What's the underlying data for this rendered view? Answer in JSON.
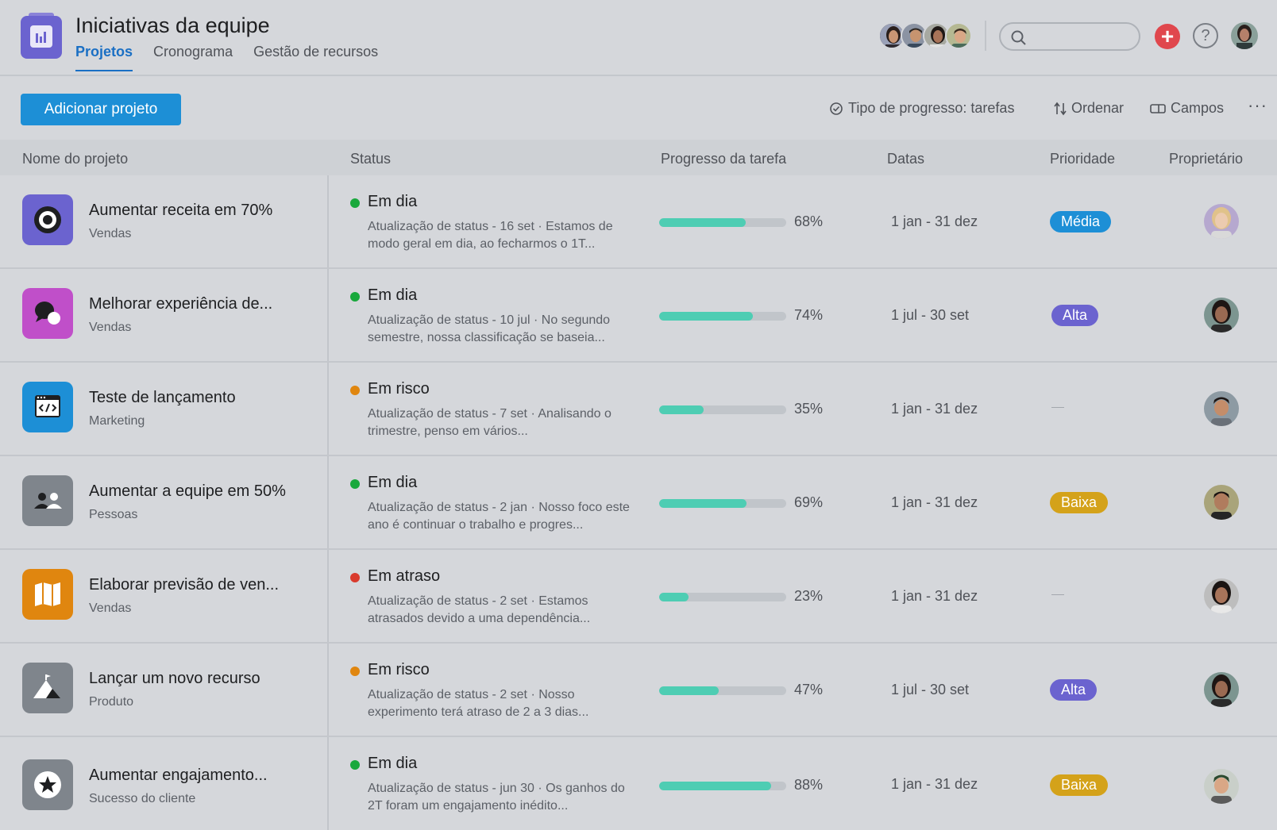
{
  "header": {
    "title": "Iniciativas da equipe",
    "tabs": [
      "Projetos",
      "Cronograma",
      "Gestão de recursos"
    ],
    "active_tab": "Projetos"
  },
  "toolbar": {
    "add_label": "Adicionar projeto",
    "progress_type_label": "Tipo de progresso: tarefas",
    "sort_label": "Ordenar",
    "fields_label": "Campos",
    "more_label": "···"
  },
  "columns": [
    "Nome do projeto",
    "Status",
    "Progresso da tarefa",
    "Datas",
    "Prioridade",
    "Proprietário"
  ],
  "colors": {
    "on_track": "#19a83c",
    "at_risk": "#e0860f",
    "late": "#d93a2d",
    "media": "#1d8fd6",
    "alta": "#6b63cf",
    "baixa": "#d4a21a",
    "progress": "#4ecdb3"
  },
  "rows": [
    {
      "name": "Aumentar receita em 70%",
      "team": "Vendas",
      "icon": "target-icon",
      "icon_color": "#6b63cf",
      "status": "Em dia",
      "status_color": "#19a83c",
      "desc": "Atualização de status - 16 set · Estamos de modo geral em dia, ao fecharmos o 1T...",
      "progress": 68,
      "progress_label": "68%",
      "dates": "1 jan - 31 dez",
      "priority": "Média",
      "priority_color": "#1d8fd6"
    },
    {
      "name": "Melhorar experiência de...",
      "team": "Vendas",
      "icon": "chat-bubbles-icon",
      "icon_color": "#c04fc9",
      "status": "Em dia",
      "status_color": "#19a83c",
      "desc": "Atualização de status - 10 jul · No segundo semestre, nossa classificação se baseia...",
      "progress": 74,
      "progress_label": "74%",
      "dates": "1 jul - 30 set",
      "priority": "Alta",
      "priority_color": "#6b63cf"
    },
    {
      "name": "Teste de lançamento",
      "team": "Marketing",
      "icon": "code-window-icon",
      "icon_color": "#1d8fd6",
      "status": "Em risco",
      "status_color": "#e0860f",
      "desc": "Atualização de status - 7 set · Analisando o trimestre, penso em vários...",
      "progress": 35,
      "progress_label": "35%",
      "dates": "1 jan - 31 dez",
      "priority": "",
      "priority_color": ""
    },
    {
      "name": "Aumentar a equipe em 50%",
      "team": "Pessoas",
      "icon": "people-icon",
      "icon_color": "#7f858c",
      "status": "Em dia",
      "status_color": "#19a83c",
      "desc": "Atualização de status - 2 jan · Nosso foco este ano é continuar o trabalho e progres...",
      "progress": 69,
      "progress_label": "69%",
      "dates": "1 jan - 31 dez",
      "priority": "Baixa",
      "priority_color": "#d4a21a"
    },
    {
      "name": "Elaborar previsão de ven...",
      "team": "Vendas",
      "icon": "map-icon",
      "icon_color": "#e0860f",
      "status": "Em atraso",
      "status_color": "#d93a2d",
      "desc": "Atualização de status - 2 set · Estamos atrasados devido a uma dependência...",
      "progress": 23,
      "progress_label": "23%",
      "dates": "1 jan - 31 dez",
      "priority": "",
      "priority_color": ""
    },
    {
      "name": "Lançar um novo recurso",
      "team": "Produto",
      "icon": "mountain-flag-icon",
      "icon_color": "#7f858c",
      "status": "Em risco",
      "status_color": "#e0860f",
      "desc": "Atualização de status - 2 set · Nosso experimento terá atraso de 2 a 3 dias...",
      "progress": 47,
      "progress_label": "47%",
      "dates": "1 jul - 30 set",
      "priority": "Alta",
      "priority_color": "#6b63cf"
    },
    {
      "name": "Aumentar engajamento...",
      "team": "Sucesso do cliente",
      "icon": "star-icon",
      "icon_color": "#7f858c",
      "status": "Em dia",
      "status_color": "#19a83c",
      "desc": "Atualização de status - jun 30 · Os ganhos do 2T foram um engajamento inédito...",
      "progress": 88,
      "progress_label": "88%",
      "dates": "1 jan - 31 dez",
      "priority": "Baixa",
      "priority_color": "#d4a21a"
    }
  ]
}
